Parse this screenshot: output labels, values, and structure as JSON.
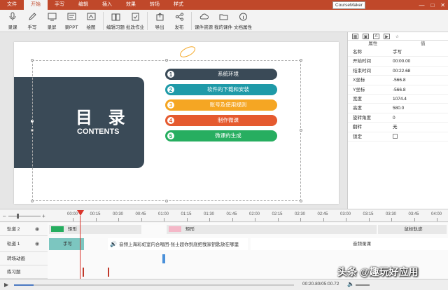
{
  "menubar": {
    "tabs": [
      "文件",
      "开始",
      "手写",
      "编辑",
      "插入",
      "效果",
      "转场",
      "样式"
    ],
    "active_index": 1,
    "brand": "CourseMaker"
  },
  "ribbon": {
    "buttons": [
      {
        "label": "录课",
        "icon": "microphone-icon"
      },
      {
        "label": "手写",
        "icon": "pen-icon"
      },
      {
        "label": "录屏",
        "icon": "screen-record-icon"
      },
      {
        "label": "录PPT",
        "icon": "ppt-record-icon"
      },
      {
        "label": "绘图",
        "icon": "draw-icon"
      },
      {
        "label": "编辑习题",
        "icon": "book-icon"
      },
      {
        "label": "批改作业",
        "icon": "grade-icon"
      },
      {
        "label": "导出",
        "icon": "export-icon"
      },
      {
        "label": "发布",
        "icon": "share-icon"
      },
      {
        "label": "课件资源",
        "icon": "cloud-icon"
      },
      {
        "label": "我的课件",
        "icon": "folder-icon"
      },
      {
        "label": "文档属性",
        "icon": "info-icon"
      }
    ]
  },
  "slide": {
    "title_cn": "目 录",
    "title_en": "CONTENTS",
    "items": [
      {
        "num": "1",
        "text": "系统环境",
        "color": "#3a4a57"
      },
      {
        "num": "2",
        "text": "软件的下载和安装",
        "color": "#1f9aa8"
      },
      {
        "num": "3",
        "text": "账号及使用规则",
        "color": "#f5a623"
      },
      {
        "num": "4",
        "text": "制作微课",
        "color": "#e55a2f"
      },
      {
        "num": "5",
        "text": "微课的生成",
        "color": "#27ae60"
      }
    ]
  },
  "properties": {
    "header_name": "属性",
    "header_value": "值",
    "rows": [
      {
        "key": "名称",
        "value": "手写"
      },
      {
        "key": "开始时间",
        "value": "00:00.00"
      },
      {
        "key": "结束时间",
        "value": "00:22.68"
      },
      {
        "key": "X坐标",
        "value": "-566.8"
      },
      {
        "key": "Y坐标",
        "value": "-566.8"
      },
      {
        "key": "宽度",
        "value": "1074.4"
      },
      {
        "key": "高度",
        "value": "580.0"
      },
      {
        "key": "旋转角度",
        "value": "0"
      },
      {
        "key": "翻转",
        "value": "无"
      },
      {
        "key": "锁定",
        "value": ""
      }
    ]
  },
  "timeline": {
    "ticks": [
      "00:00",
      "00:15",
      "00:30",
      "00:45",
      "01:00",
      "01:15",
      "01:30",
      "01:45",
      "02:00",
      "02:15",
      "02:30",
      "02:45",
      "03:00",
      "03:15",
      "03:30",
      "03:45",
      "04:00",
      "04:15"
    ],
    "tracks": [
      {
        "name": "轨道 2",
        "clips": [
          {
            "label": "矩形",
            "color": "#e8e8e8",
            "swatch": "#27ae60"
          },
          {
            "label": "矩形",
            "color": "#e8e8e8",
            "swatch": "#f4b8c8"
          },
          {
            "label": "鼠标轨迹",
            "color": "#e8e8e8",
            "swatch": ""
          }
        ]
      },
      {
        "name": "轨道 1",
        "clips": [
          {
            "label": "手写",
            "color": "#7cc6c0",
            "swatch": ""
          },
          {
            "label": "音频上海彩虹室内合唱团-张士超你到底把我家钥匙放在哪里",
            "color": "#ffffff",
            "swatch": ""
          },
          {
            "label": "音频录课",
            "color": "#ffffff",
            "swatch": ""
          }
        ]
      },
      {
        "name": "转场动画",
        "clips": []
      },
      {
        "name": "练习题",
        "clips": []
      }
    ]
  },
  "bottombar": {
    "time": "00:20.80/05:00.72",
    "progress": 0.07
  },
  "watermark": "头条 @趣玩好应用"
}
